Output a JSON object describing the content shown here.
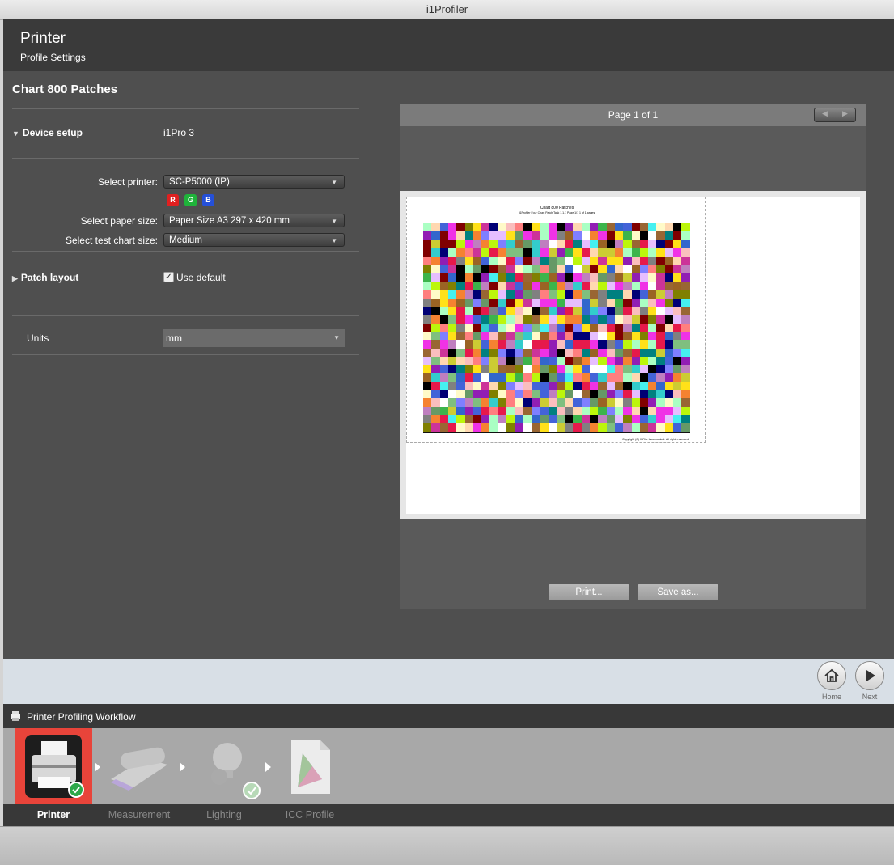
{
  "window": {
    "title": "i1Profiler"
  },
  "header": {
    "title": "Printer",
    "subtitle": "Profile Settings"
  },
  "chart_section": {
    "title": "Chart 800 Patches"
  },
  "device_setup": {
    "label": "Device setup",
    "value": "i1Pro 3"
  },
  "printer": {
    "label": "Select printer:",
    "value": "SC-P5000 (IP)",
    "channels": [
      {
        "letter": "R",
        "color": "#e02020"
      },
      {
        "letter": "G",
        "color": "#1fb33a"
      },
      {
        "letter": "B",
        "color": "#2550d8"
      }
    ]
  },
  "paper_size": {
    "label": "Select paper size:",
    "value": "Paper Size A3  297 x 420 mm"
  },
  "test_chart_size": {
    "label": "Select test chart size:",
    "value": "Medium"
  },
  "patch_layout": {
    "label": "Patch layout",
    "checkbox_label": "Use default",
    "checked": true
  },
  "units": {
    "label": "Units",
    "value": "mm"
  },
  "preview": {
    "page_label": "Page 1 of 1",
    "chart_title": "Chart 800 Patches",
    "chart_subtitle": "i1Profiler Four Chart Patch Task 1.1.1 Page 1/1 1 of 1 pages",
    "copyright": "Copyright (C) X-Rite Incorporated. All rights reserved.",
    "print_label": "Print...",
    "save_label": "Save as..."
  },
  "nav": {
    "home_label": "Home",
    "next_label": "Next"
  },
  "workflow": {
    "title": "Printer Profiling Workflow",
    "steps": [
      {
        "label": "Printer",
        "active": true
      },
      {
        "label": "Measurement",
        "active": false
      },
      {
        "label": "Lighting",
        "active": false
      },
      {
        "label": "ICC Profile",
        "active": false
      }
    ]
  },
  "colors": {
    "accent_active": "#e8443a",
    "panel_dark": "#3a3a3a",
    "panel_mid": "#4f4f4f"
  }
}
